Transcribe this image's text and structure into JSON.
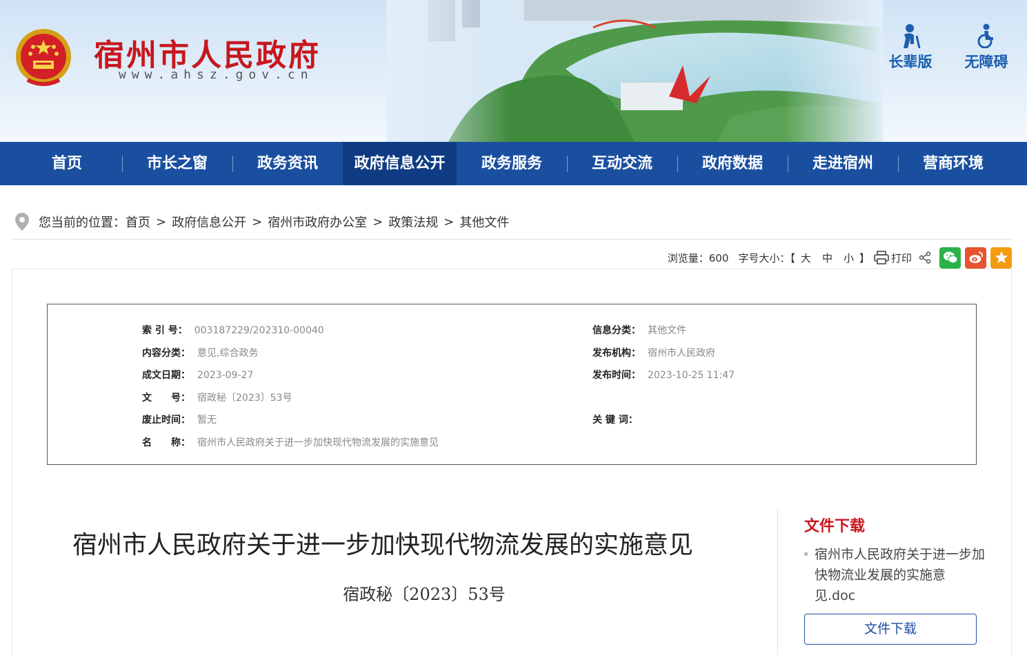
{
  "header": {
    "site_name": "宿州市人民政府",
    "site_url": "www.ahsz.gov.cn",
    "tools": [
      {
        "label": "长辈版",
        "icon": "elder-icon"
      },
      {
        "label": "无障碍",
        "icon": "accessibility-icon"
      }
    ]
  },
  "nav": {
    "items": [
      "首页",
      "市长之窗",
      "政务资讯",
      "政府信息公开",
      "政务服务",
      "互动交流",
      "政府数据",
      "走进宿州",
      "营商环境"
    ],
    "active_index": 3
  },
  "breadcrumb": {
    "prefix": "您当前的位置：",
    "items": [
      "首页",
      "政府信息公开",
      "宿州市政府办公室",
      "政策法规",
      "其他文件"
    ],
    "separator": ">"
  },
  "toolbar": {
    "views": "浏览量：600",
    "font_size_label": "字号大小：",
    "bracket_open": "【",
    "bracket_close": "】",
    "sizes": [
      "大",
      "中",
      "小"
    ],
    "print": "打印"
  },
  "meta": {
    "index_no_label": "索 引 号：",
    "index_no": "003187229/202310-00040",
    "category_label": "信息分类：",
    "category": "其他文件",
    "content_type_label": "内容分类：",
    "content_type": "意见,综合政务",
    "publisher_label": "发布机构：",
    "publisher": "宿州市人民政府",
    "created_label": "成文日期：",
    "created": "2023-09-27",
    "published_label": "发布时间：",
    "published": "2023-10-25 11:47",
    "doc_no_label": "文　　号：",
    "doc_no": "宿政秘〔2023〕53号",
    "expire_label": "废止时间：",
    "expire": "暂无",
    "keywords_label": "关 键 词：",
    "name_label": "名　　称：",
    "name": "宿州市人民政府关于进一步加快现代物流发展的实施意见"
  },
  "document": {
    "title": "宿州市人民政府关于进一步加快现代物流发展的实施意见",
    "number": "宿政秘〔2023〕53号"
  },
  "download": {
    "title": "文件下载",
    "file_name": "宿州市人民政府关于进一步加快物流业发展的实施意见.doc",
    "button": "文件下载"
  },
  "colors": {
    "brand_blue": "#1a4fa0",
    "brand_red": "#c8161d",
    "wechat": "#2bb14a",
    "weibo": "#e8522f",
    "favorite": "#f39c12"
  }
}
